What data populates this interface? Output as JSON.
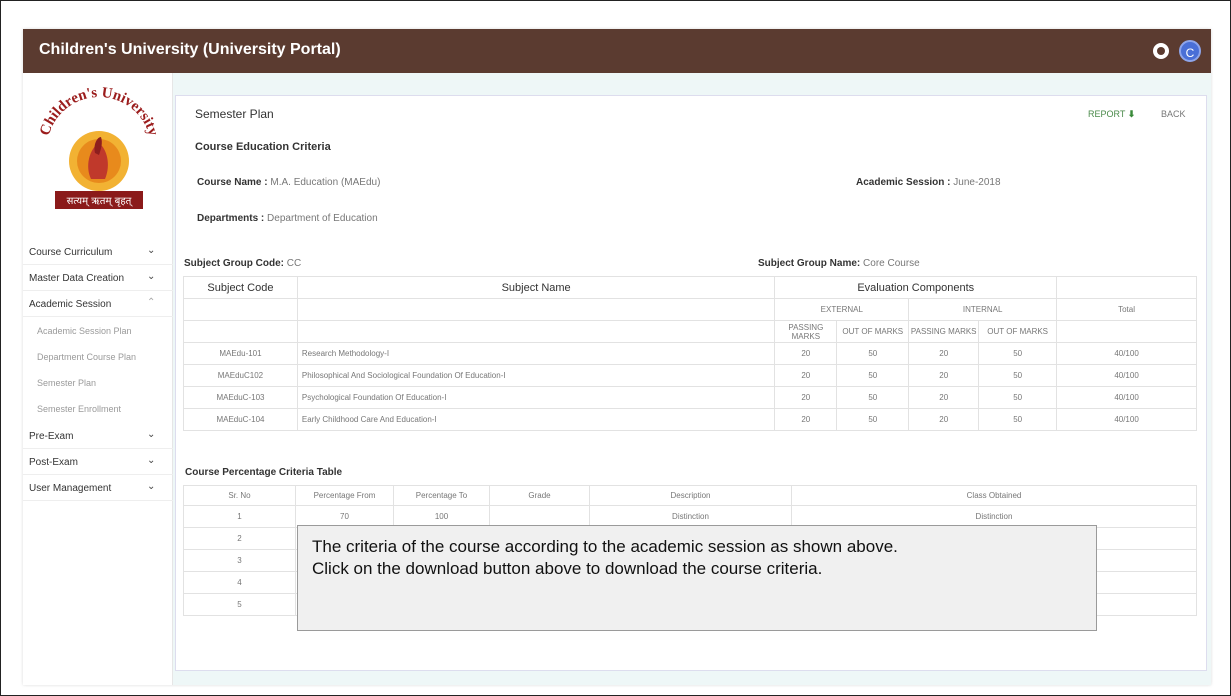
{
  "header": {
    "title": "Children's University (University Portal)",
    "avatar_initial": "C"
  },
  "logo": {
    "text_top": "Children's University",
    "text_bottom": "सत्यम् ऋतम् बृहत्"
  },
  "sidebar": {
    "items": [
      {
        "label": "Course Curriculum",
        "chev": "⌄"
      },
      {
        "label": "Master Data Creation",
        "chev": "⌄"
      },
      {
        "label": "Academic Session",
        "chev": "⌃"
      },
      {
        "label": "Pre-Exam",
        "chev": "⌄"
      },
      {
        "label": "Post-Exam",
        "chev": "⌄"
      },
      {
        "label": "User Management",
        "chev": "⌄"
      }
    ],
    "sub_items": [
      {
        "label": "Academic Session Plan"
      },
      {
        "label": "Department Course Plan"
      },
      {
        "label": "Semester Plan"
      },
      {
        "label": "Semester Enrollment"
      }
    ]
  },
  "page": {
    "title": "Semester Plan",
    "report_label": "REPORT",
    "back_label": "BACK",
    "section_title": "Course Education Criteria",
    "course_name_label": "Course Name :",
    "course_name_value": "M.A. Education (MAEdu)",
    "academic_session_label": "Academic Session :",
    "academic_session_value": "June-2018",
    "departments_label": "Departments :",
    "departments_value": "Department of Education",
    "subject_group_code_label": "Subject Group Code:",
    "subject_group_code_value": "CC",
    "subject_group_name_label": "Subject Group Name:",
    "subject_group_name_value": "Core Course"
  },
  "subject_table": {
    "headers": {
      "code": "Subject Code",
      "name": "Subject Name",
      "eval": "Evaluation Components",
      "external": "EXTERNAL",
      "internal": "INTERNAL",
      "total": "Total",
      "ext_pass": "PASSING MARKS",
      "ext_out": "OUT OF MARKS",
      "int_pass": "PASSING MARKS",
      "int_out": "OUT OF MARKS"
    },
    "rows": [
      {
        "code": "MAEdu-101",
        "name": "Research Methodology-I",
        "ext_pass": "20",
        "ext_out": "50",
        "int_pass": "20",
        "int_out": "50",
        "total": "40/100"
      },
      {
        "code": "MAEduC102",
        "name": "Philosophical And Sociological Foundation Of Education-I",
        "ext_pass": "20",
        "ext_out": "50",
        "int_pass": "20",
        "int_out": "50",
        "total": "40/100"
      },
      {
        "code": "MAEduC-103",
        "name": "Psychological Foundation Of Education-I",
        "ext_pass": "20",
        "ext_out": "50",
        "int_pass": "20",
        "int_out": "50",
        "total": "40/100"
      },
      {
        "code": "MAEduC-104",
        "name": "Early Childhood Care And Education-I",
        "ext_pass": "20",
        "ext_out": "50",
        "int_pass": "20",
        "int_out": "50",
        "total": "40/100"
      }
    ]
  },
  "percentage_table": {
    "title": "Course Percentage Criteria Table",
    "headers": {
      "sr": "Sr. No",
      "from": "Percentage From",
      "to": "Percentage To",
      "grade": "Grade",
      "description": "Description",
      "class": "Class Obtained"
    },
    "rows": [
      {
        "sr": "1",
        "from": "70",
        "to": "100",
        "grade": "",
        "description": "Distinction",
        "class": "Distinction"
      },
      {
        "sr": "2",
        "from": "",
        "to": "",
        "grade": "",
        "description": "",
        "class": ""
      },
      {
        "sr": "3",
        "from": "",
        "to": "",
        "grade": "",
        "description": "",
        "class": ""
      },
      {
        "sr": "4",
        "from": "",
        "to": "",
        "grade": "",
        "description": "",
        "class": ""
      },
      {
        "sr": "5",
        "from": "",
        "to": "",
        "grade": "",
        "description": "",
        "class": ""
      }
    ]
  },
  "tooltip": {
    "line1": "The criteria of the course according to the academic session as shown above.",
    "line2": "Click on the download button above to download the course criteria."
  },
  "colors": {
    "topbar": "#5b3b30",
    "content_bg": "#eef7f7",
    "avatar": "#4a6fd6",
    "report_green": "#4a8a4a"
  }
}
